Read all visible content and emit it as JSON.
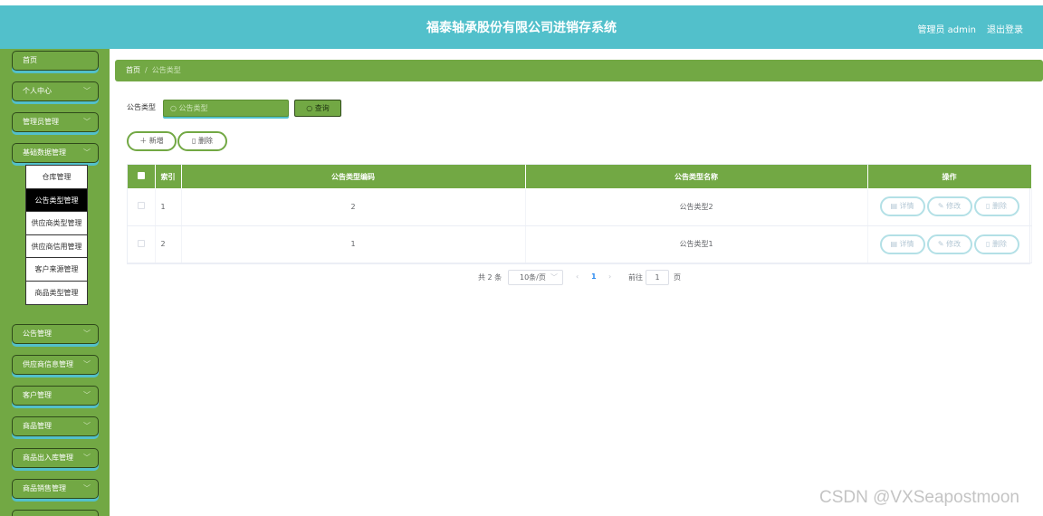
{
  "header": {
    "title": "福泰轴承股份有限公司进销存系统",
    "user": "管理员 admin",
    "logout": "退出登录"
  },
  "sidebar": {
    "items": [
      {
        "label": "首页",
        "has_arrow": false
      },
      {
        "label": "个人中心",
        "has_arrow": true
      },
      {
        "label": "管理员管理",
        "has_arrow": true
      },
      {
        "label": "基础数据管理",
        "has_arrow": true,
        "expanded": true
      },
      {
        "label": "公告管理",
        "has_arrow": true
      },
      {
        "label": "供应商信息管理",
        "has_arrow": true
      },
      {
        "label": "客户管理",
        "has_arrow": true
      },
      {
        "label": "商品管理",
        "has_arrow": true
      },
      {
        "label": "商品出入库管理",
        "has_arrow": true
      },
      {
        "label": "商品销售管理",
        "has_arrow": true
      }
    ],
    "submenu": [
      {
        "label": "仓库管理",
        "active": false
      },
      {
        "label": "公告类型管理",
        "active": true
      },
      {
        "label": "供应商类型管理",
        "active": false
      },
      {
        "label": "供应商信用管理",
        "active": false
      },
      {
        "label": "客户来源管理",
        "active": false
      },
      {
        "label": "商品类型管理",
        "active": false
      }
    ]
  },
  "breadcrumb": {
    "home": "首页",
    "separator": "/",
    "current": "公告类型"
  },
  "search": {
    "label": "公告类型",
    "placeholder": "公告类型",
    "button": "查询"
  },
  "toolbar": {
    "add": "新增",
    "delete": "删除"
  },
  "table": {
    "columns": [
      "索引",
      "公告类型编码",
      "公告类型名称",
      "操作"
    ],
    "rows": [
      {
        "index": "1",
        "code": "2",
        "name": "公告类型2"
      },
      {
        "index": "2",
        "code": "1",
        "name": "公告类型1"
      }
    ],
    "actions": {
      "detail": "详情",
      "edit": "修改",
      "delete": "删除"
    }
  },
  "pagination": {
    "total": "共 2 条",
    "page_size": "10条/页",
    "current_page": "1",
    "goto_label": "前往",
    "goto_value": "1",
    "page_unit": "页"
  },
  "watermark": "CSDN @VXSeapostmoon",
  "colors": {
    "header": "#52c0cb",
    "sidebar": "#72a844",
    "accent_underline": "#52c0cb",
    "page_link": "#2d8cf0"
  }
}
